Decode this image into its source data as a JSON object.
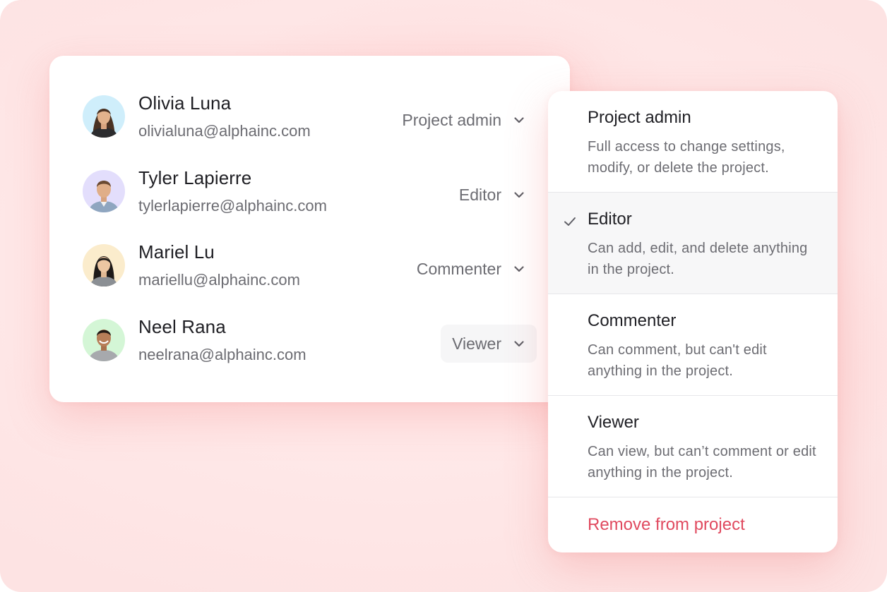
{
  "members": [
    {
      "name": "Olivia Luna",
      "email": "olivialuna@alphainc.com",
      "role": "Project admin",
      "avatar_bg": "#cfeefb"
    },
    {
      "name": "Tyler Lapierre",
      "email": "tylerlapierre@alphainc.com",
      "role": "Editor",
      "avatar_bg": "#e3defc"
    },
    {
      "name": "Mariel Lu",
      "email": "mariellu@alphainc.com",
      "role": "Commenter",
      "avatar_bg": "#fbeccc"
    },
    {
      "name": "Neel Rana",
      "email": "neelrana@alphainc.com",
      "role": "Viewer",
      "avatar_bg": "#d4f6d6"
    }
  ],
  "role_menu": {
    "options": [
      {
        "title": "Project admin",
        "description": "Full access to change settings, modify, or delete the project.",
        "selected": false
      },
      {
        "title": "Editor",
        "description": "Can add, edit, and delete anything in the project.",
        "selected": true
      },
      {
        "title": "Commenter",
        "description": "Can comment, but can't edit anything in the project.",
        "selected": false
      },
      {
        "title": "Viewer",
        "description": "Can view, but can’t comment or edit anything in the project.",
        "selected": false
      }
    ],
    "remove_label": "Remove from project"
  },
  "icons": {
    "chevron": "chevron-down-icon",
    "check": "check-icon"
  },
  "colors": {
    "background": "#ffe6e6",
    "danger": "#e04a5f",
    "text_primary": "#1f1f24",
    "text_secondary": "#6c6c72",
    "selected_bg": "#f7f7f8"
  }
}
